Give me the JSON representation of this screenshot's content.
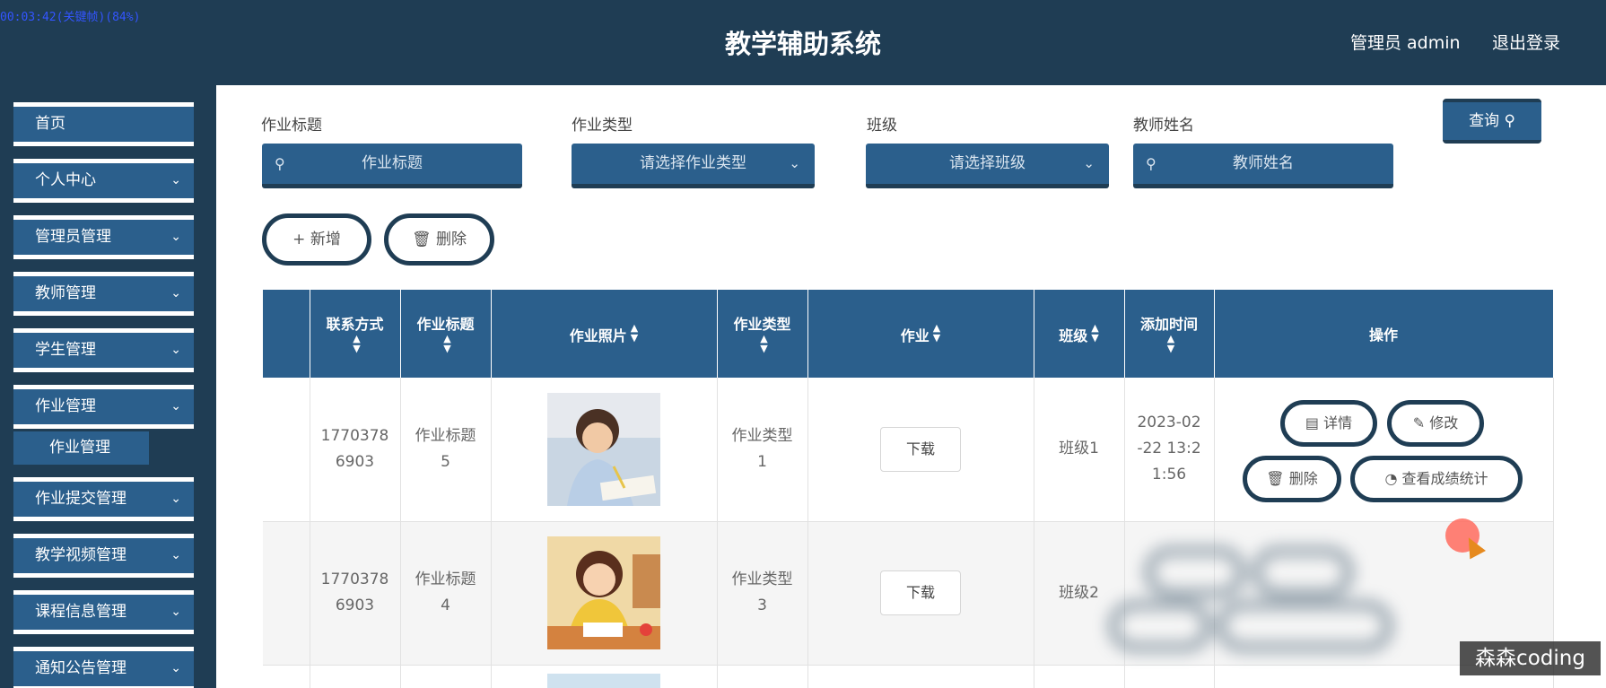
{
  "overlay": {
    "recording": "00:03:42(关键帧)(84%)",
    "watermark": "森森coding"
  },
  "header": {
    "title": "教学辅助系统",
    "admin": "管理员 admin",
    "logout": "退出登录"
  },
  "sidebar": {
    "items": [
      {
        "label": "首页"
      },
      {
        "label": "个人中心"
      },
      {
        "label": "管理员管理"
      },
      {
        "label": "教师管理"
      },
      {
        "label": "学生管理"
      },
      {
        "label": "作业管理"
      },
      {
        "label": "作业提交管理"
      },
      {
        "label": "教学视频管理"
      },
      {
        "label": "课程信息管理"
      },
      {
        "label": "通知公告管理"
      }
    ],
    "active_sub": "作业管理"
  },
  "filters": {
    "title_label": "作业标题",
    "title_placeholder": "作业标题",
    "type_label": "作业类型",
    "type_placeholder": "请选择作业类型",
    "class_label": "班级",
    "class_placeholder": "请选择班级",
    "teacher_label": "教师姓名",
    "teacher_placeholder": "教师姓名",
    "query": "查询"
  },
  "toolbar": {
    "add": "新增",
    "delete": "删除"
  },
  "table": {
    "headers": {
      "contact": "联系方式",
      "title": "作业标题",
      "photo": "作业照片",
      "type": "作业类型",
      "homework": "作业",
      "class": "班级",
      "time": "添加时间",
      "actions": "操作"
    },
    "rows": [
      {
        "contact_a": "1770378",
        "contact_b": "6903",
        "title_a": "作业标题",
        "title_b": "5",
        "type_a": "作业类型",
        "type_b": "1",
        "download": "下载",
        "class": "班级1",
        "time_a": "2023-02",
        "time_b": "-22 13:2",
        "time_c": "1:56"
      },
      {
        "contact_a": "1770378",
        "contact_b": "6903",
        "title_a": "作业标题",
        "title_b": "4",
        "type_a": "作业类型",
        "type_b": "3",
        "download": "下载",
        "class": "班级2"
      }
    ],
    "actions": {
      "detail": "详情",
      "edit": "修改",
      "delete": "删除",
      "stats": "查看成绩统计"
    }
  },
  "colors": {
    "header_bg": "#1f3d54",
    "accent": "#2b5f8c",
    "white": "#ffffff"
  }
}
